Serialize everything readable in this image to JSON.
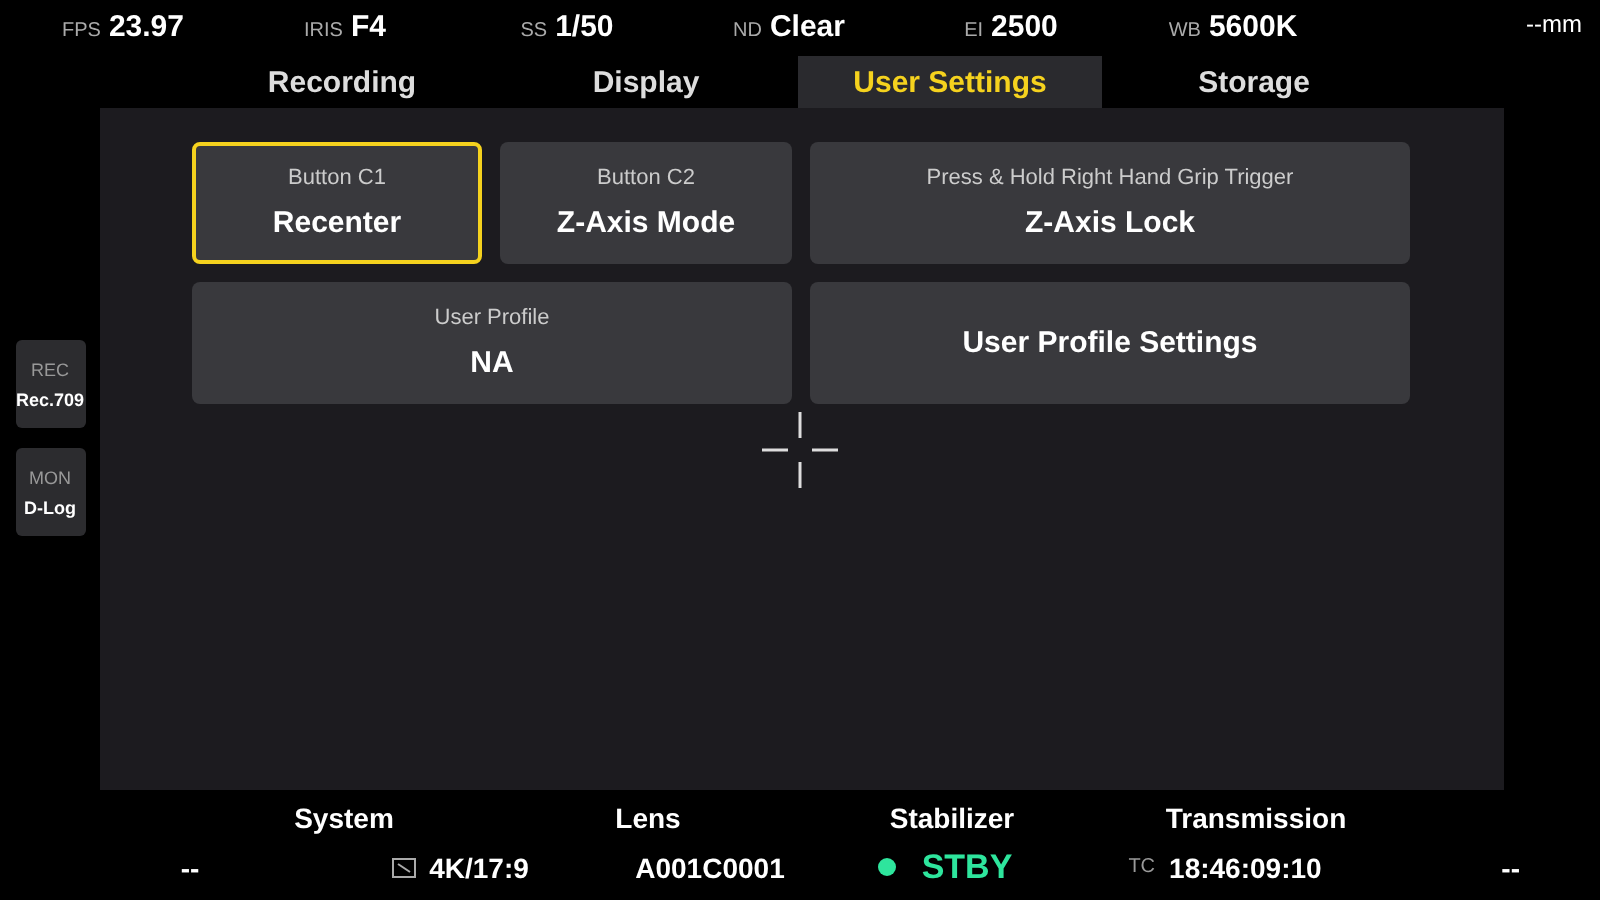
{
  "top_stats": [
    {
      "label": "FPS",
      "value": "23.97"
    },
    {
      "label": "IRIS",
      "value": "F4"
    },
    {
      "label": "SS",
      "value": "1/50"
    },
    {
      "label": "ND",
      "value": "Clear"
    },
    {
      "label": "EI",
      "value": "2500"
    },
    {
      "label": "WB",
      "value": "5600K"
    },
    {
      "value": "--mm"
    }
  ],
  "tabs": [
    {
      "label": "Recording",
      "selected": false
    },
    {
      "label": "Display",
      "selected": false
    },
    {
      "label": "User Settings",
      "selected": true
    },
    {
      "label": "Storage",
      "selected": false
    }
  ],
  "side_buttons": [
    {
      "label": "REC",
      "value": "Rec.709"
    },
    {
      "label": "MON",
      "value": "D-Log"
    }
  ],
  "card_rows": [
    [
      {
        "title": "Button C1",
        "value": "Recenter",
        "selected": true
      },
      {
        "title": "Button C2",
        "value": "Z-Axis Mode",
        "selected": false
      },
      {
        "title": "Press & Hold Right Hand Grip Trigger",
        "value": "Z-Axis Lock",
        "selected": false
      }
    ],
    [
      {
        "title": "User Profile",
        "value": "NA",
        "selected": false
      },
      {
        "value": "User Profile Settings",
        "selected": false
      }
    ]
  ],
  "bottom_labels": [
    "System",
    "Lens",
    "Stabilizer",
    "Transmission"
  ],
  "bottom_values": [
    {
      "kind": "text",
      "value": "--"
    },
    {
      "kind": "icon",
      "value": "4K/17:9"
    },
    {
      "kind": "text",
      "value": "A001C0001"
    },
    {
      "kind": "dot",
      "value": "STBY",
      "color": "#2ee59d"
    },
    {
      "kind": "prefixed",
      "prefix": "TC",
      "value": "18:46:09:10"
    },
    {
      "kind": "text",
      "value": "--"
    }
  ]
}
